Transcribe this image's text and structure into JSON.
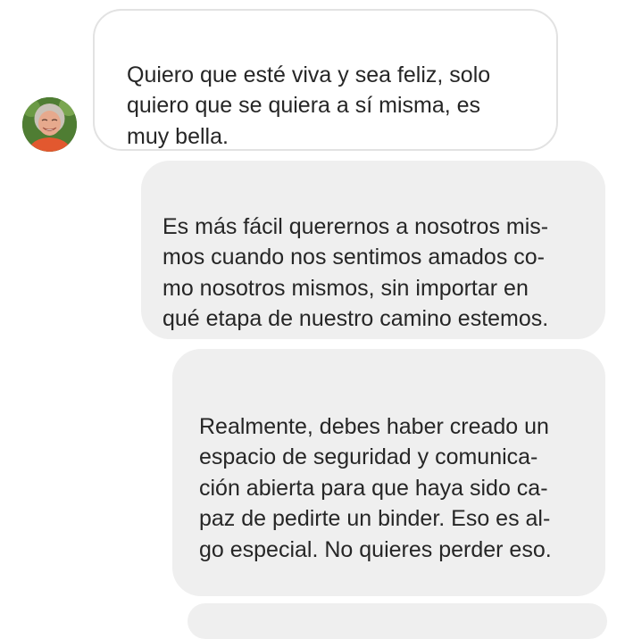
{
  "messages": [
    {
      "id": "msg1",
      "direction": "incoming",
      "text": "Quiero que esté viva y sea feliz, solo\nquiero que se quiera a sí misma, es\nmuy bella."
    },
    {
      "id": "msg2",
      "direction": "outgoing",
      "text": "Es más fácil querernos a nosotros mis-\nmos cuando nos sentimos amados co-\nmo nosotros mismos, sin importar en\nqué etapa de nuestro camino estemos."
    },
    {
      "id": "msg3",
      "direction": "outgoing",
      "text": "Realmente, debes haber creado un\nespacio de seguridad y comunica-\nción abierta para que haya sido ca-\npaz de pedirte un binder. Eso es al-\ngo especial. No quieres perder eso."
    }
  ],
  "avatar": {
    "icon": "user-avatar-photo"
  },
  "colors": {
    "incoming_bg": "#ffffff",
    "incoming_border": "#e2e2e2",
    "outgoing_bg": "#efefef",
    "text": "#262626"
  }
}
